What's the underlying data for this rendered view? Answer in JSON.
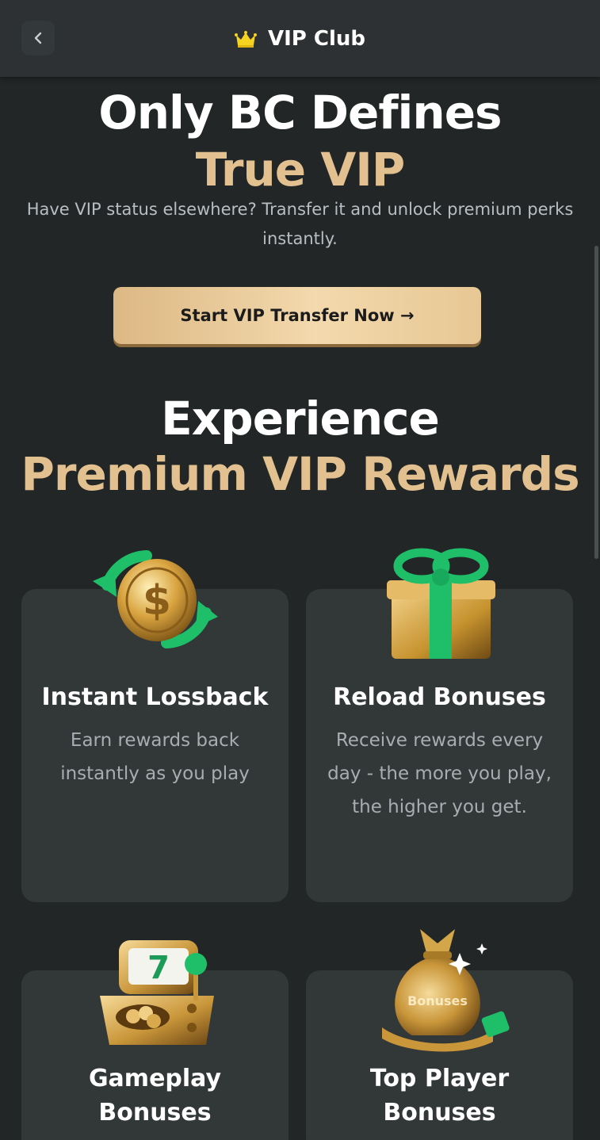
{
  "header": {
    "title": "VIP Club",
    "back_icon": "chevron-left-icon",
    "crown_icon": "crown-icon",
    "crown_color": "#f7d321"
  },
  "hero": {
    "line1": "Only BC Defines",
    "line2": "True VIP",
    "subtitle": "Have VIP status elsewhere? Transfer it and unlock premium perks instantly.",
    "cta_label": "Start VIP Transfer Now →"
  },
  "section": {
    "line1": "Experience",
    "line2": "Premium VIP Rewards"
  },
  "cards": [
    {
      "title": "Instant Lossback",
      "desc": "Earn rewards back instantly as you play",
      "icon": "coin-refresh-icon"
    },
    {
      "title": "Reload Bonuses",
      "desc": "Receive rewards every day - the more you play, the higher you get.",
      "icon": "gift-box-icon"
    },
    {
      "title": "Gameplay Bonuses",
      "desc": "",
      "icon": "slot-machine-icon"
    },
    {
      "title": "Top Player Bonuses",
      "desc": "",
      "icon": "money-bag-icon",
      "bag_label": "Bonuses"
    }
  ],
  "colors": {
    "background": "#232626",
    "card": "#323738",
    "gold": "#e2c08f",
    "green": "#1fbf6a"
  }
}
